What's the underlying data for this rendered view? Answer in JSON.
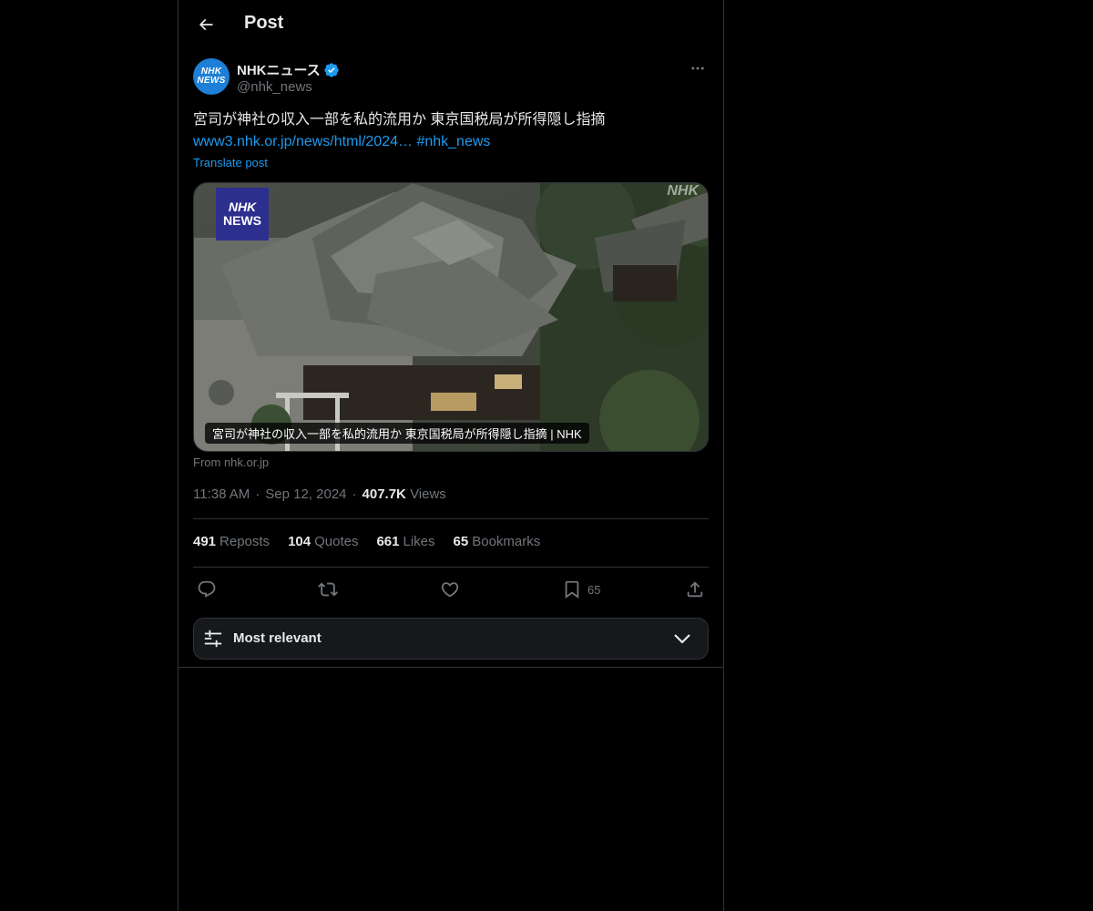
{
  "header": {
    "title": "Post"
  },
  "author": {
    "name": "NHKニュース",
    "handle": "@nhk_news",
    "avatar_text_top": "NHK",
    "avatar_text_bottom": "NEWS"
  },
  "post": {
    "text": "宮司が神社の収入一部を私的流用か 東京国税局が所得隠し指摘",
    "link": "www3.nhk.or.jp/news/html/2024…",
    "hashtag": "#nhk_news",
    "translate_label": "Translate post"
  },
  "card": {
    "logo_top": "NHK",
    "logo_bottom": "NEWS",
    "watermark": "NHK",
    "caption": "宮司が神社の収入一部を私的流用か 東京国税局が所得隠し指摘 | NHK",
    "source": "From nhk.or.jp"
  },
  "meta": {
    "time": "11:38 AM",
    "sep1": "·",
    "date": "Sep 12, 2024",
    "sep2": "·",
    "views_count": "407.7K",
    "views_label": "Views"
  },
  "stats": [
    {
      "count": "491",
      "label": "Reposts"
    },
    {
      "count": "104",
      "label": "Quotes"
    },
    {
      "count": "661",
      "label": "Likes"
    },
    {
      "count": "65",
      "label": "Bookmarks"
    }
  ],
  "actions": {
    "bookmark_count": "65"
  },
  "sort": {
    "label": "Most relevant"
  },
  "colors": {
    "background": "#000000",
    "text": "#e7e9ea",
    "muted": "#71767b",
    "accent": "#1d9bf0",
    "border": "#2f3336"
  }
}
